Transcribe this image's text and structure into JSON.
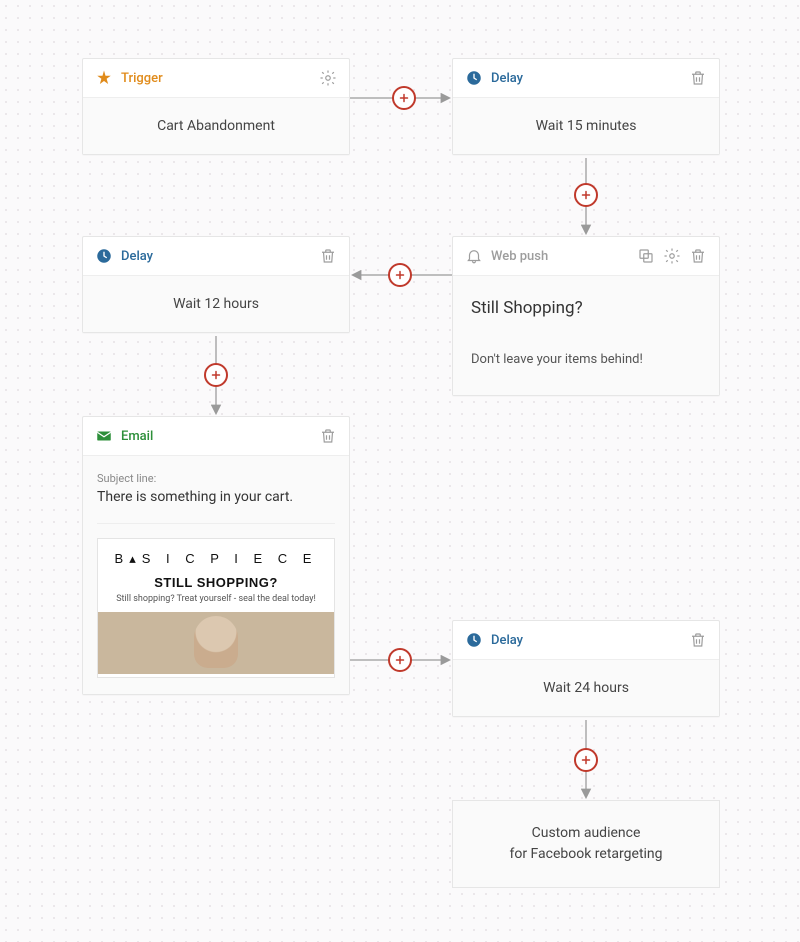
{
  "nodes": {
    "trigger": {
      "type_label": "Trigger",
      "content": "Cart Abandonment"
    },
    "delay15": {
      "type_label": "Delay",
      "content": "Wait 15 minutes"
    },
    "webpush": {
      "type_label": "Web push",
      "title": "Still Shopping?",
      "message": "Don't leave your items behind!"
    },
    "delay12": {
      "type_label": "Delay",
      "content": "Wait 12 hours"
    },
    "email": {
      "type_label": "Email",
      "subject_label": "Subject line:",
      "subject": "There is something in your cart.",
      "preview": {
        "brand": "B▴S I C  P I E C E",
        "headline": "STILL SHOPPING?",
        "sub": "Still shopping? Treat yourself - seal the deal today!"
      }
    },
    "delay24": {
      "type_label": "Delay",
      "content": "Wait 24 hours"
    },
    "custom_audience": {
      "line1": "Custom audience",
      "line2": "for Facebook retargeting"
    }
  }
}
